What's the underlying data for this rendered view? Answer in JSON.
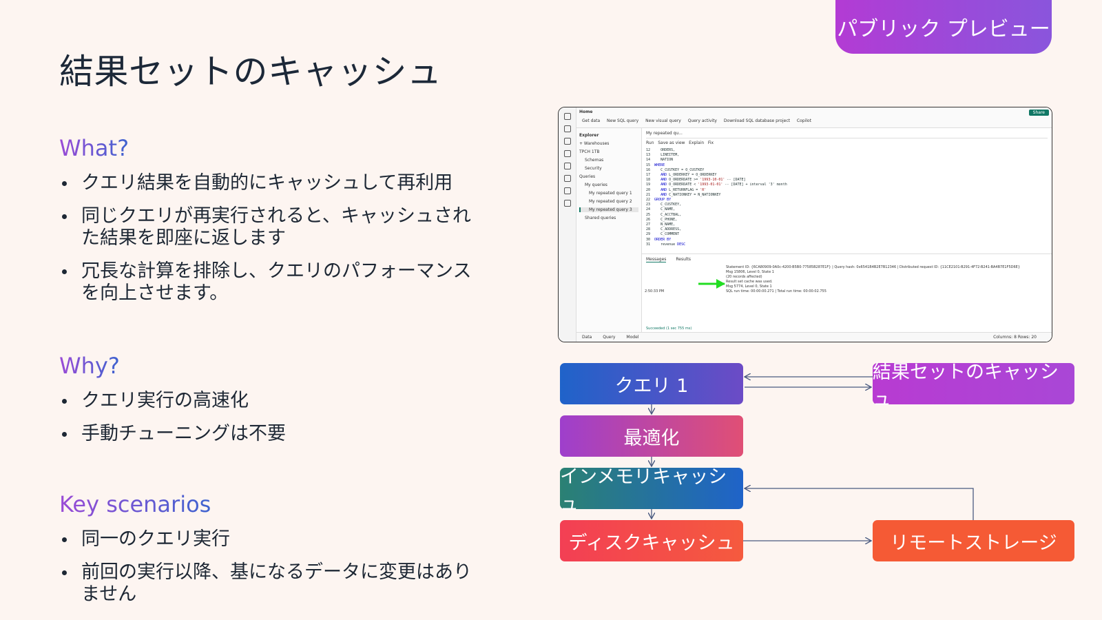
{
  "badge": "パブリック プレビュー",
  "title": "結果セットのキャッシュ",
  "sections": [
    {
      "heading": "What?",
      "bullets": [
        "クエリ結果を自動的にキャッシュして再利用",
        "同じクエリが再実行されると、キャッシュされた結果を即座に返します",
        "冗長な計算を排除し、クエリのパフォーマンスを向上させます。"
      ]
    },
    {
      "heading": "Why?",
      "bullets": [
        "クエリ実行の高速化",
        "手動チューニングは不要"
      ]
    },
    {
      "heading": "Key scenarios",
      "bullets": [
        "同一のクエリ実行",
        "前回の実行以降、基になるデータに変更はありません"
      ]
    }
  ],
  "screenshot": {
    "ribbon_home": "Home",
    "ribbon_items": [
      "Get data",
      "New SQL query",
      "New visual query",
      "Query activity",
      "Download SQL database project",
      "Copilot"
    ],
    "share": "Share",
    "explorer_title": "Explorer",
    "explorer_items": [
      "+ Warehouses",
      "TPCH 1TB",
      "Schemas",
      "Security",
      "Queries",
      "My queries",
      "My repeated query 1",
      "My repeated query 2",
      "My repeated query 3",
      "Shared queries"
    ],
    "query_tab": "My repeated qu...",
    "editor_toolbar": [
      "Run",
      "Save as view",
      "Explain",
      "Fix"
    ],
    "messages_tab": "Messages",
    "results_tab": "Results",
    "log_lines": [
      "Statement ID: {6CA80909-0A0c-4200-B5B0-77585B287E1F} | Query hash: 0x6541B4B2E7B12346 | Distributed request ID: {11CE2101-B291-4F72-B241-BA4B7E1F5D6E}",
      "Msg 15806, Level 0, State 1",
      "(20 records affected)",
      "Result set cache was used.",
      "Msg 5774, Level 0, State 1",
      "SQL run time: 00:00:00.271 | Total run time: 00:00:02.755"
    ],
    "log_time": "2:50:33 PM",
    "status": "Succeeded (1 sec 755 ms)",
    "bottom_tabs": [
      "Data",
      "Query",
      "Model"
    ],
    "columns_rows": "Columns: 8  Rows: 20"
  },
  "flow": {
    "query": "クエリ 1",
    "optimize": "最適化",
    "memory_cache": "インメモリキャッシュ",
    "disk_cache": "ディスクキャッシュ",
    "result_cache": "結果セットのキャッシュ",
    "remote_storage": "リモートストレージ"
  }
}
